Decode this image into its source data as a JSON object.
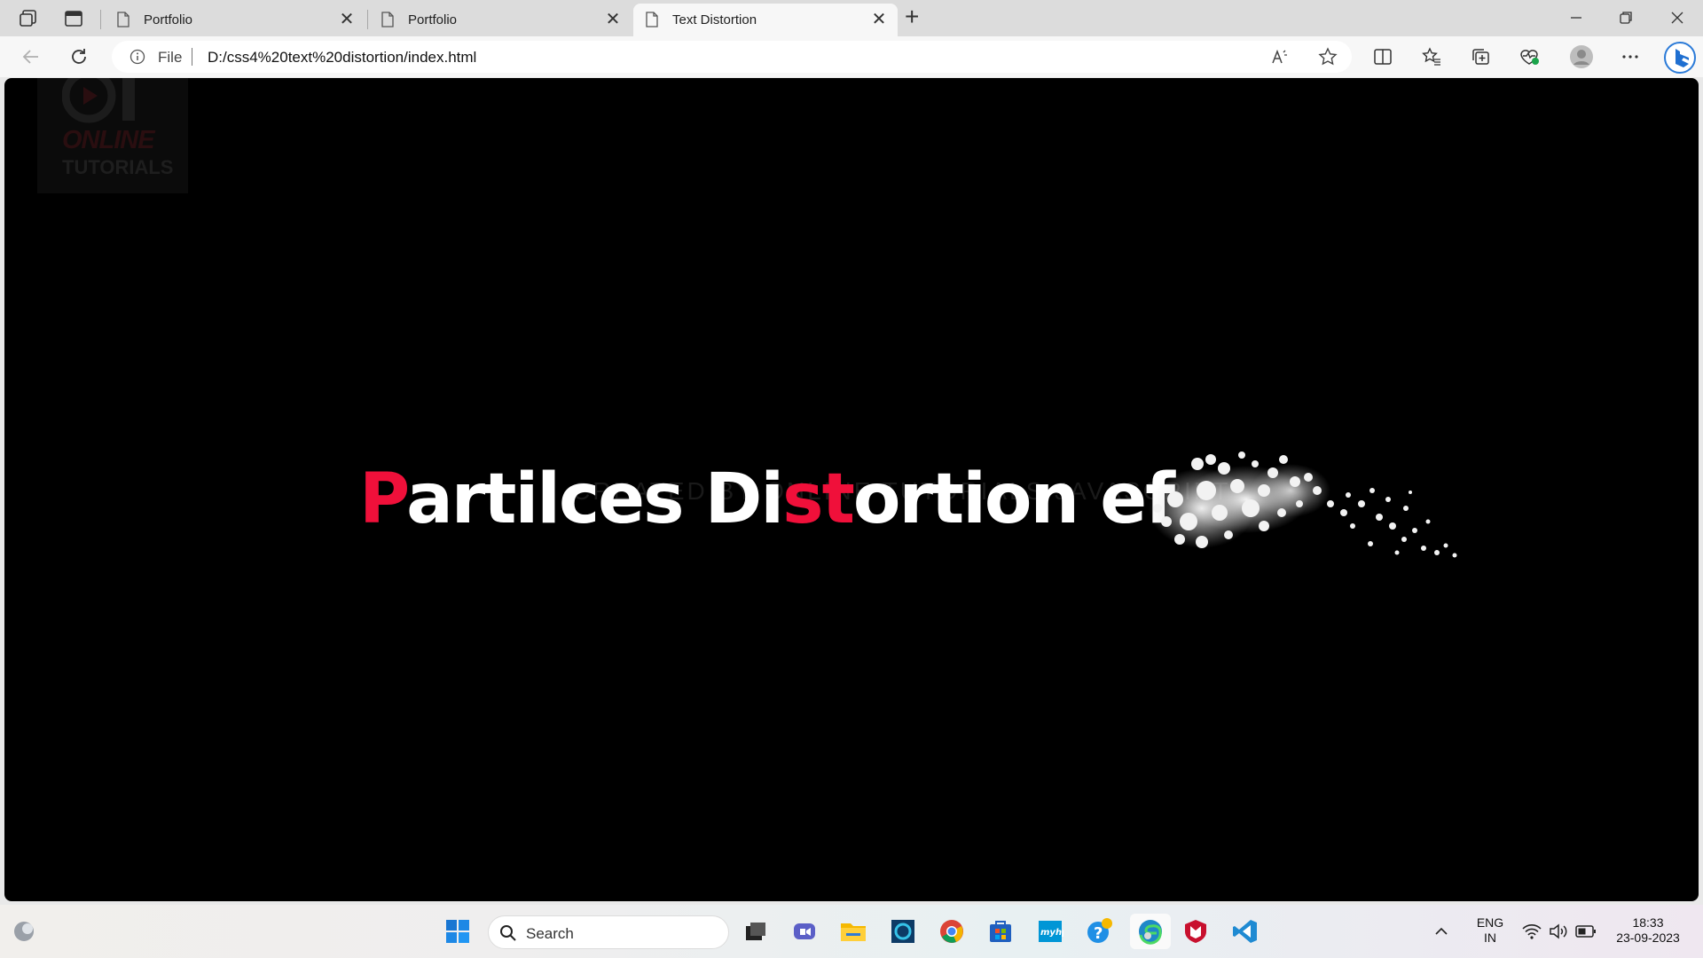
{
  "browser": {
    "tabs": [
      {
        "label": "Portfolio",
        "close": "✕"
      },
      {
        "label": "Portfolio",
        "close": "✕"
      },
      {
        "label": "Text Distortion",
        "close": "✕"
      }
    ],
    "new_tab": "+",
    "address": {
      "scheme_label": "File",
      "url": "D:/css4%20text%20distortion/index.html"
    },
    "window_controls": [
      "minimize",
      "restore",
      "close"
    ]
  },
  "page": {
    "logo": {
      "line1": "ONLINE",
      "line2": "TUTORIALS"
    },
    "headline": {
      "part1_red": "P",
      "part2": "artilces Di",
      "part3_red": "st",
      "part4": "ortion ef"
    },
    "subtitle": "CREATED BY ONLINE TUTORIALS JAVASCRIPT"
  },
  "taskbar": {
    "search_placeholder": "Search",
    "language": {
      "line1": "ENG",
      "line2": "IN"
    },
    "clock": {
      "time": "18:33",
      "date": "23-09-2023"
    }
  },
  "colors": {
    "accent_red": "#f0103a",
    "page_bg": "#000000",
    "headline_text": "#ffffff"
  },
  "icons": [
    "workspaces-icon",
    "tab-actions-icon",
    "document-icon",
    "back-icon",
    "refresh-icon",
    "info-icon",
    "read-aloud-icon",
    "favorite-star-icon",
    "split-screen-icon",
    "favorites-icon",
    "collections-icon",
    "browser-essentials-icon",
    "profile-icon",
    "more-icon",
    "bing-copilot-icon",
    "windows-start-icon",
    "search-icon",
    "task-view-icon",
    "teams-icon",
    "file-explorer-icon",
    "cortana-icon",
    "chrome-icon",
    "store-icon",
    "myhp-icon",
    "help-icon",
    "edge-icon",
    "mcafee-icon",
    "vscode-icon",
    "chevron-up-icon",
    "wifi-icon",
    "volume-icon",
    "battery-icon"
  ]
}
